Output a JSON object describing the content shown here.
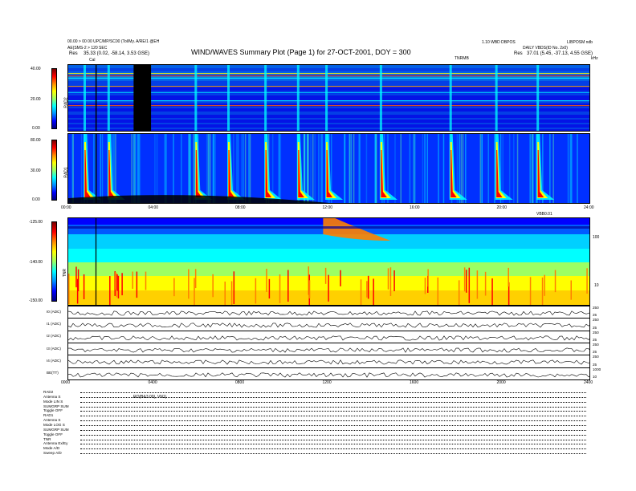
{
  "header": {
    "title": "WIND/WAVES Summary Plot (Page 1) for 27-OCT-2001, DOY = 300",
    "left_line1": "00.00 > 00 00 UPC/MP/SC00 (Tol/My. A/RE/1 @EH",
    "left_line2": "AE(SMS-2 > 120 SEC",
    "left_res_label": "Res",
    "left_res_value": "35.33 (0.02, -58.14, 3.53 GSE)",
    "right_line1": "1.10 WBD DBPOS",
    "right_line2": "DAILY VBDS(ID No. 2x0)",
    "right_res_label": "Res",
    "right_res_value": "37.01 (5.45, -37.13, 4.55 GSE)",
    "right_top": "LIBPOSM ndb",
    "marker_label": "Cal",
    "tnr_label": "TNRMB",
    "khz_label": "kHz"
  },
  "rad2": {
    "label": "RAD2",
    "yticks": [
      "40.00",
      "20.00",
      "0.00"
    ]
  },
  "rad1": {
    "label": "RAD1",
    "yticks": [
      "80.00",
      "30.00",
      "0.00"
    ]
  },
  "tnr": {
    "label": "TNR",
    "yticks": [
      "-125.00",
      "-140.00",
      "-150.00"
    ],
    "right_ticks": [
      "100",
      "10"
    ],
    "top_right": "VBB0.01"
  },
  "middle_axis_labels": [
    "00:00",
    "04:00",
    "08:00",
    "12:00",
    "16:00",
    "20:00",
    "24:00"
  ],
  "bottom_axis_labels": [
    "0000",
    "0400",
    "0800",
    "1200",
    "1600",
    "2000",
    "2400"
  ],
  "line_panels": [
    {
      "label": "I0 (ADC)",
      "ticks": [
        "250",
        "25"
      ]
    },
    {
      "label": "I1 (ADC)",
      "ticks": [
        "250",
        "25"
      ]
    },
    {
      "label": "I2 (ADC)",
      "ticks": [
        "250",
        "25"
      ]
    },
    {
      "label": "I3 (ADC)",
      "ticks": [
        "250",
        "25"
      ]
    },
    {
      "label": "I4 (ADC)",
      "ticks": [
        "250",
        "25"
      ]
    },
    {
      "label": "BE(TT)",
      "ticks": [
        "1000",
        "10"
      ]
    }
  ],
  "footer_rows": [
    {
      "k": "RAD2",
      "v": ""
    },
    {
      "k": "Antenna",
      "v": "S"
    },
    {
      "k": "Mode",
      "v": "LIN S"
    },
    {
      "k": "SUMGRP",
      "v": "SUM"
    },
    {
      "k": "Toggle",
      "v": "OFF"
    },
    {
      "k": "RAD1",
      "v": ""
    },
    {
      "k": "Antenna",
      "v": "S"
    },
    {
      "k": "Mode",
      "v": "LOG S"
    },
    {
      "k": "SUMGRP",
      "v": "SUM"
    },
    {
      "k": "Toggle",
      "v": "OFF"
    },
    {
      "k": "TNR",
      "v": ""
    },
    {
      "k": "Antenna",
      "v": "Ex/Ey"
    },
    {
      "k": "Mode",
      "v": "A/D"
    },
    {
      "k": "Sweep",
      "v": "A/D"
    }
  ],
  "footer_note": "RO(B&3 00), VN1)",
  "colors": {
    "bg": "#000080",
    "blue": "#0000ff",
    "cyan": "#00ffff",
    "yellow": "#ffff00",
    "red": "#ff0000"
  },
  "chart_data": {
    "type": "heatmap",
    "title": "WIND/WAVES Summary Plot (Page 1) for 27-OCT-2001, DOY = 300",
    "xlabel": "",
    "ylabel": "",
    "xlim": [
      0,
      24
    ],
    "panels": [
      {
        "name": "RAD2",
        "ylim": [
          0,
          40
        ],
        "colorbar": "jet"
      },
      {
        "name": "RAD1",
        "ylim": [
          0,
          80
        ],
        "colorbar": "jet"
      },
      {
        "name": "TNR",
        "ylim": [
          -150,
          -125
        ],
        "colorbar": "jet"
      }
    ],
    "burst_times_hr": [
      0.7,
      1.8,
      5.8,
      7.3,
      9.0,
      10.5,
      11.8,
      14.3,
      17.5,
      19.6,
      21.5
    ],
    "datagap_hr": [
      3.0,
      3.8
    ],
    "vertical_marker_hr": 1.25,
    "tnr_enhancement_hr": [
      11.7,
      14.8
    ],
    "grid": false
  }
}
